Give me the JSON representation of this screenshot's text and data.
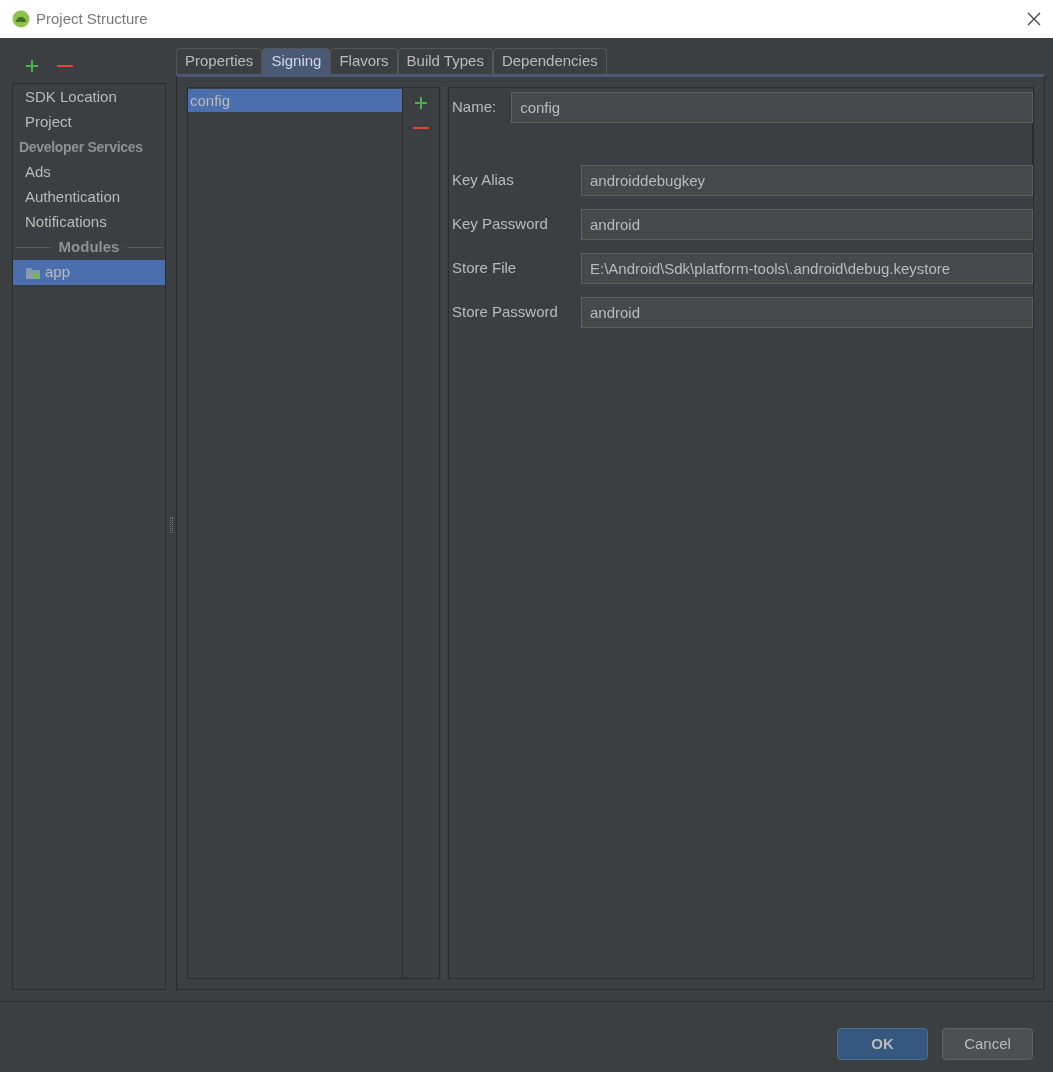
{
  "window": {
    "title": "Project Structure"
  },
  "sidebar": {
    "items": [
      {
        "kind": "item",
        "label": "SDK Location",
        "selected": false
      },
      {
        "kind": "item",
        "label": "Project",
        "selected": false
      },
      {
        "kind": "header",
        "label": "Developer Services"
      },
      {
        "kind": "item",
        "label": "Ads",
        "selected": false
      },
      {
        "kind": "item",
        "label": "Authentication",
        "selected": false
      },
      {
        "kind": "item",
        "label": "Notifications",
        "selected": false
      },
      {
        "kind": "separator",
        "label": "Modules"
      },
      {
        "kind": "module",
        "label": "app",
        "selected": true
      }
    ]
  },
  "tabs": [
    {
      "label": "Properties",
      "selected": false
    },
    {
      "label": "Signing",
      "selected": true
    },
    {
      "label": "Flavors",
      "selected": false
    },
    {
      "label": "Build Types",
      "selected": false
    },
    {
      "label": "Dependencies",
      "selected": false
    }
  ],
  "configs": [
    {
      "label": "config",
      "selected": true
    }
  ],
  "form": {
    "name": {
      "label": "Name:",
      "value": "config"
    },
    "fields": [
      {
        "label": "Key Alias",
        "value": "androiddebugkey"
      },
      {
        "label": "Key Password",
        "value": "android"
      },
      {
        "label": "Store File",
        "value": "E:\\Android\\Sdk\\platform-tools\\.android\\debug.keystore"
      },
      {
        "label": "Store Password",
        "value": "android"
      }
    ]
  },
  "buttons": [
    {
      "label": "OK",
      "kind": "primary"
    },
    {
      "label": "Cancel",
      "kind": "secondary"
    }
  ]
}
